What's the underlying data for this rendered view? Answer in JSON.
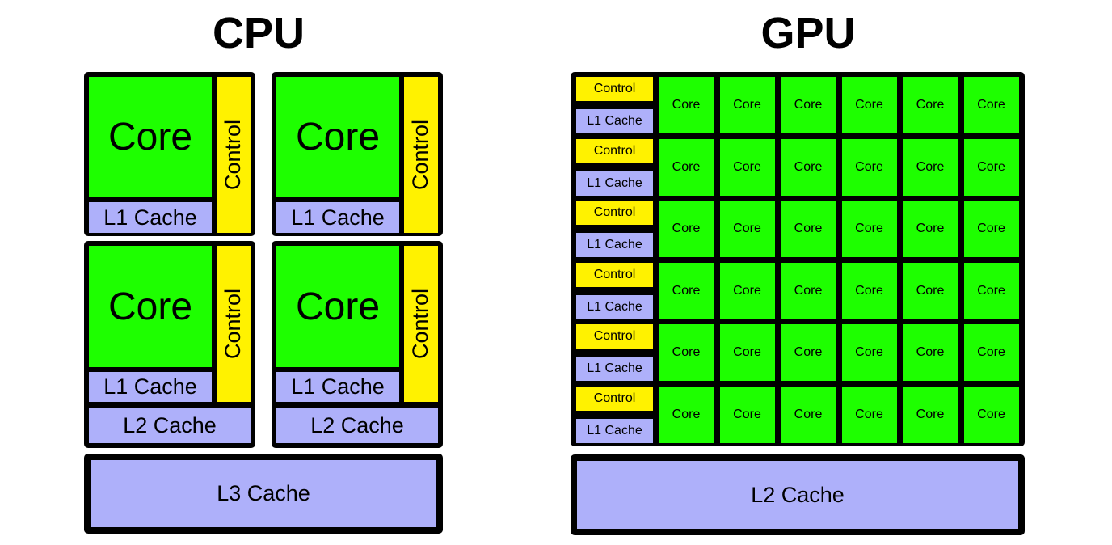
{
  "colors": {
    "core": "#1eff00",
    "control": "#fff200",
    "cache": "#aeb0fa",
    "border": "#000000"
  },
  "cpu": {
    "title": "CPU",
    "cores": [
      {
        "core_label": "Core",
        "control_label": "Control",
        "l1_label": "L1 Cache"
      },
      {
        "core_label": "Core",
        "control_label": "Control",
        "l1_label": "L1 Cache"
      },
      {
        "core_label": "Core",
        "control_label": "Control",
        "l1_label": "L1 Cache",
        "l2_label": "L2 Cache"
      },
      {
        "core_label": "Core",
        "control_label": "Control",
        "l1_label": "L1 Cache",
        "l2_label": "L2 Cache"
      }
    ],
    "l3_label": "L3 Cache"
  },
  "gpu": {
    "title": "GPU",
    "rows": [
      {
        "control_label": "Control",
        "l1_label": "L1 Cache",
        "cores": [
          "Core",
          "Core",
          "Core",
          "Core",
          "Core",
          "Core"
        ]
      },
      {
        "control_label": "Control",
        "l1_label": "L1 Cache",
        "cores": [
          "Core",
          "Core",
          "Core",
          "Core",
          "Core",
          "Core"
        ]
      },
      {
        "control_label": "Control",
        "l1_label": "L1 Cache",
        "cores": [
          "Core",
          "Core",
          "Core",
          "Core",
          "Core",
          "Core"
        ]
      },
      {
        "control_label": "Control",
        "l1_label": "L1 Cache",
        "cores": [
          "Core",
          "Core",
          "Core",
          "Core",
          "Core",
          "Core"
        ]
      },
      {
        "control_label": "Control",
        "l1_label": "L1 Cache",
        "cores": [
          "Core",
          "Core",
          "Core",
          "Core",
          "Core",
          "Core"
        ]
      },
      {
        "control_label": "Control",
        "l1_label": "L1 Cache",
        "cores": [
          "Core",
          "Core",
          "Core",
          "Core",
          "Core",
          "Core"
        ]
      }
    ],
    "l2_label": "L2 Cache"
  }
}
